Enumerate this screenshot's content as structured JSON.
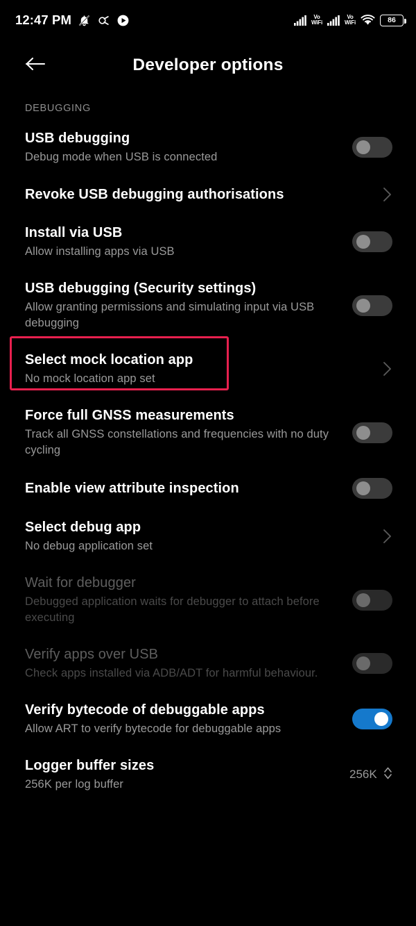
{
  "status_bar": {
    "time": "12:47 PM",
    "left_icons": [
      "notifications-muted-icon",
      "data-saver-icon",
      "media-play-icon"
    ],
    "right_icons": [
      "signal-bars-sim1-icon",
      "volte-wifi-sim1-icon",
      "signal-bars-sim2-icon",
      "volte-wifi-sim2-icon",
      "wifi-icon",
      "battery-icon"
    ],
    "vowifi_line1": "Vo",
    "vowifi_line2": "WiFi",
    "battery_level": "86"
  },
  "app_bar": {
    "back_icon": "arrow-left-icon",
    "title": "Developer options"
  },
  "section": {
    "label": "DEBUGGING"
  },
  "highlight": {
    "color": "#e8204e",
    "target": "Select mock location app"
  },
  "rows": [
    {
      "title": "USB debugging",
      "subtitle": "Debug mode when USB is connected",
      "control": "toggle",
      "state": "off",
      "enabled": true
    },
    {
      "title": "Revoke USB debugging authorisations",
      "subtitle": "",
      "control": "chevron",
      "state": "",
      "enabled": true
    },
    {
      "title": "Install via USB",
      "subtitle": "Allow installing apps via USB",
      "control": "toggle",
      "state": "off",
      "enabled": true
    },
    {
      "title": "USB debugging (Security settings)",
      "subtitle": "Allow granting permissions and simulating input via USB debugging",
      "control": "toggle",
      "state": "off",
      "enabled": true
    },
    {
      "title": "Select mock location app",
      "subtitle": "No mock location app set",
      "control": "chevron",
      "state": "",
      "enabled": true,
      "highlighted": true
    },
    {
      "title": "Force full GNSS measurements",
      "subtitle": "Track all GNSS constellations and frequencies with no duty cycling",
      "control": "toggle",
      "state": "off",
      "enabled": true
    },
    {
      "title": "Enable view attribute inspection",
      "subtitle": "",
      "control": "toggle",
      "state": "off",
      "enabled": true
    },
    {
      "title": "Select debug app",
      "subtitle": "No debug application set",
      "control": "chevron",
      "state": "",
      "enabled": true
    },
    {
      "title": "Wait for debugger",
      "subtitle": "Debugged application waits for debugger to attach before executing",
      "control": "toggle",
      "state": "off",
      "enabled": false
    },
    {
      "title": "Verify apps over USB",
      "subtitle": "Check apps installed via ADB/ADT for harmful behaviour.",
      "control": "toggle",
      "state": "off",
      "enabled": false
    },
    {
      "title": "Verify bytecode of debuggable apps",
      "subtitle": "Allow ART to verify bytecode for debuggable apps",
      "control": "toggle",
      "state": "on",
      "enabled": true
    },
    {
      "title": "Logger buffer sizes",
      "subtitle": "256K per log buffer",
      "control": "stepper",
      "value": "256K",
      "enabled": true
    }
  ]
}
